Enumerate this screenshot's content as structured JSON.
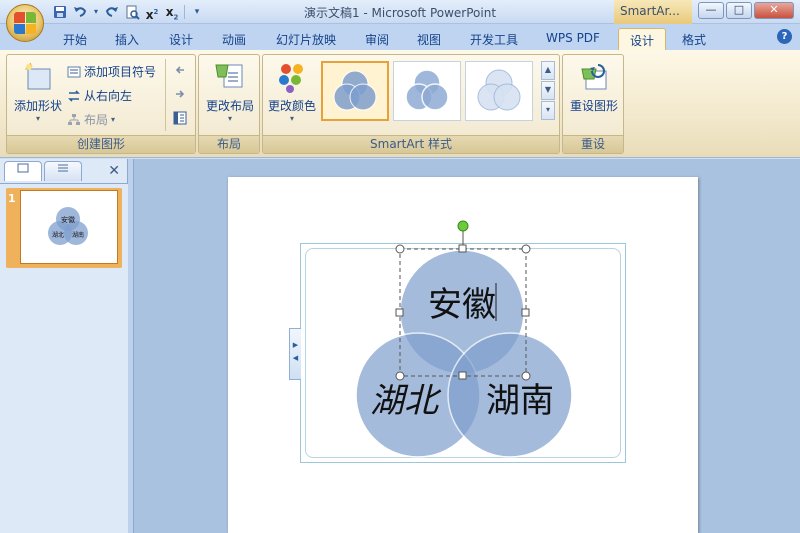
{
  "window": {
    "title": "演示文稿1 - Microsoft PowerPoint",
    "context_title": "SmartAr...",
    "minimize": "—",
    "maximize": "□",
    "close": "✕"
  },
  "quick_access": [
    "save-icon",
    "undo-icon",
    "redo-icon",
    "print-preview-icon",
    "superscript-icon",
    "subscript-icon",
    "customize-icon"
  ],
  "tabs": [
    {
      "label": "开始",
      "active": false
    },
    {
      "label": "插入",
      "active": false
    },
    {
      "label": "设计",
      "active": false
    },
    {
      "label": "动画",
      "active": false
    },
    {
      "label": "幻灯片放映",
      "active": false
    },
    {
      "label": "审阅",
      "active": false
    },
    {
      "label": "视图",
      "active": false
    },
    {
      "label": "开发工具",
      "active": false
    },
    {
      "label": "WPS PDF",
      "active": false
    },
    {
      "label": "设计",
      "active": true
    },
    {
      "label": "格式",
      "active": false
    }
  ],
  "help_label": "?",
  "ribbon": {
    "create_graphic": {
      "label": "创建图形",
      "add_shape": "添加形状",
      "add_bullet": "添加项目符号",
      "right_to_left": "从右向左",
      "layout": "布局"
    },
    "layouts": {
      "label": "布局",
      "change_layout": "更改布局"
    },
    "smartart_styles": {
      "label": "SmartArt 样式",
      "change_colors": "更改颜色",
      "gallery": [
        "style-1",
        "style-2",
        "style-3"
      ],
      "selected_index": 0
    },
    "reset": {
      "label": "重设",
      "reset_graphic": "重设图形"
    }
  },
  "left_pane": {
    "slide_number": "1",
    "thumb_labels": [
      "安徽",
      "湖北",
      "湖南"
    ]
  },
  "slide": {
    "venn_labels": {
      "top": "安徽",
      "left": "湖北",
      "right": "湖南"
    }
  },
  "colors": {
    "circle_fill": "#7f9fcd",
    "ribbon_bg": "#fdf8e7",
    "accent": "#e6a23a"
  }
}
